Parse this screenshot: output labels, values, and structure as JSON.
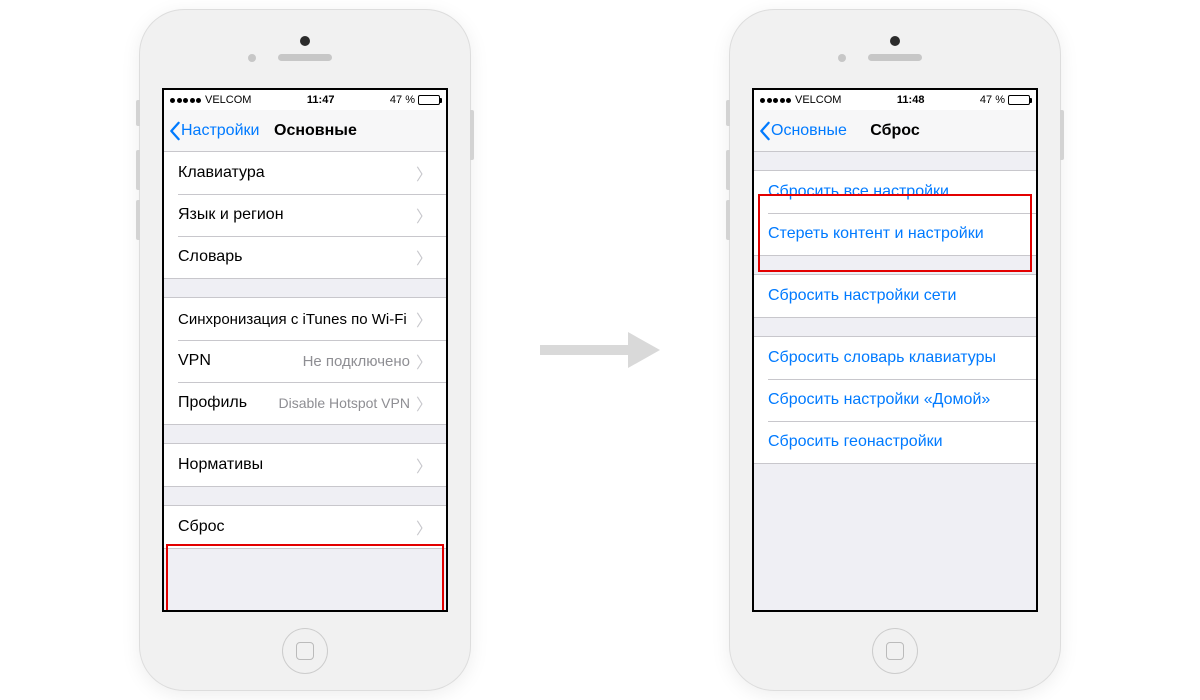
{
  "statusbar": {
    "carrier": "VELCOM",
    "time1": "11:47",
    "time2": "11:48",
    "battery_pct": "47 %",
    "battery_fill_pct": 47
  },
  "left_phone": {
    "back_label": "Настройки",
    "title": "Основные",
    "group1": [
      {
        "label": "Клавиатура"
      },
      {
        "label": "Язык и регион"
      },
      {
        "label": "Словарь"
      }
    ],
    "group2": [
      {
        "label": "Синхронизация с iTunes по Wi-Fi"
      },
      {
        "label": "VPN",
        "value": "Не подключено"
      },
      {
        "label": "Профиль",
        "value": "Disable Hotspot VPN"
      }
    ],
    "group3": [
      {
        "label": "Нормативы"
      }
    ],
    "group4": [
      {
        "label": "Сброс"
      }
    ]
  },
  "right_phone": {
    "back_label": "Основные",
    "title": "Сброс",
    "group1": [
      {
        "label": "Сбросить все настройки"
      },
      {
        "label": "Стереть контент и настройки"
      }
    ],
    "group2": [
      {
        "label": "Сбросить настройки сети"
      }
    ],
    "group3": [
      {
        "label": "Сбросить словарь клавиатуры"
      },
      {
        "label": "Сбросить настройки «Домой»"
      },
      {
        "label": "Сбросить геонастройки"
      }
    ]
  }
}
